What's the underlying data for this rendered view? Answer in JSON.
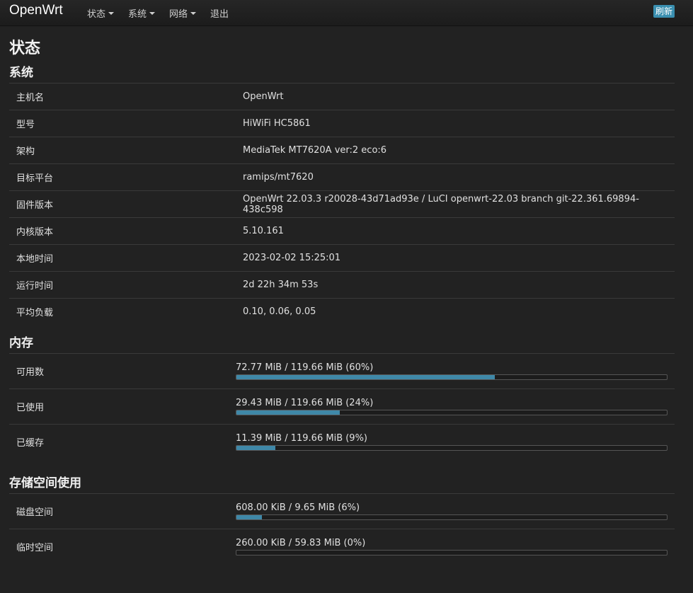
{
  "nav": {
    "brand": "OpenWrt",
    "menu": [
      "状态",
      "系统",
      "网络",
      "退出"
    ],
    "refresh": "刷新"
  },
  "page_title": "状态",
  "system": {
    "title": "系统",
    "rows": [
      {
        "label": "主机名",
        "value": "OpenWrt"
      },
      {
        "label": "型号",
        "value": "HiWiFi HC5861"
      },
      {
        "label": "架构",
        "value": "MediaTek MT7620A ver:2 eco:6"
      },
      {
        "label": "目标平台",
        "value": "ramips/mt7620"
      },
      {
        "label": "固件版本",
        "value": "OpenWrt 22.03.3 r20028-43d71ad93e / LuCI openwrt-22.03 branch git-22.361.69894-438c598"
      },
      {
        "label": "内核版本",
        "value": "5.10.161"
      },
      {
        "label": "本地时间",
        "value": "2023-02-02 15:25:01"
      },
      {
        "label": "运行时间",
        "value": "2d 22h 34m 53s"
      },
      {
        "label": "平均负载",
        "value": "0.10, 0.06, 0.05"
      }
    ]
  },
  "memory": {
    "title": "内存",
    "rows": [
      {
        "label": "可用数",
        "value": "72.77 MiB / 119.66 MiB (60%)",
        "fraction": 0.6
      },
      {
        "label": "已使用",
        "value": "29.43 MiB / 119.66 MiB (24%)",
        "fraction": 0.24
      },
      {
        "label": "已缓存",
        "value": "11.39 MiB / 119.66 MiB (9%)",
        "fraction": 0.09
      }
    ]
  },
  "storage": {
    "title": "存储空间使用",
    "rows": [
      {
        "label": "磁盘空间",
        "value": "608.00 KiB / 9.65 MiB (6%)",
        "fraction": 0.06
      },
      {
        "label": "临时空间",
        "value": "260.00 KiB / 59.83 MiB (0%)",
        "fraction": 0.0
      }
    ]
  },
  "colors": {
    "accent": "#3f88a8",
    "refresh_button": "#3a8fb0",
    "background": "#222222"
  }
}
